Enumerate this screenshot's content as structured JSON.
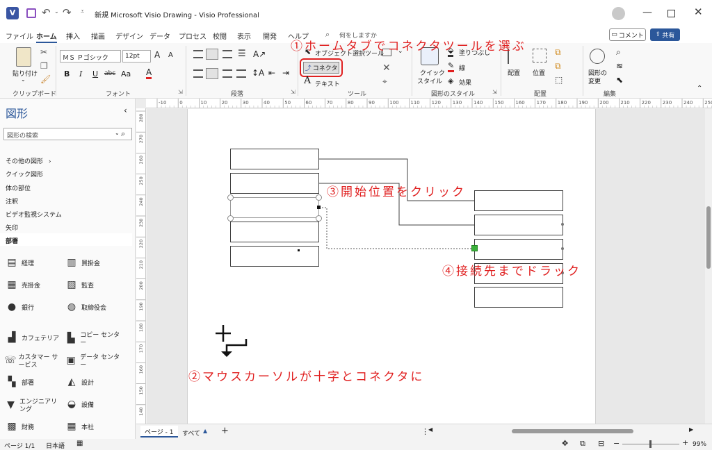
{
  "titlebar": {
    "title": "新規 Microsoft Visio Drawing  -  Visio Professional",
    "app_icon": "visio-icon",
    "save_icon": "save-icon"
  },
  "menubar": {
    "tabs": [
      "ファイル",
      "ホーム",
      "挿入",
      "描画",
      "デザイン",
      "データ",
      "プロセス",
      "校閲",
      "表示",
      "開発",
      "ヘルプ"
    ],
    "active_tab": "ホーム",
    "search_placeholder": "何をしますか",
    "comment_label": "コメント",
    "share_label": "共有"
  },
  "ribbon": {
    "clipboard": {
      "paste": "貼り付け",
      "label": "クリップボード"
    },
    "font": {
      "family": "ＭＳ Ｐゴシック",
      "size": "12pt",
      "bold": "B",
      "italic": "I",
      "underline": "U",
      "strike": "abc",
      "case": "Aa",
      "color": "A",
      "grow": "A",
      "shrink": "A",
      "label": "フォント"
    },
    "paragraph": {
      "label": "段落"
    },
    "tools": {
      "pointer": "オブジェクト選択ツール",
      "connector": "コネクタ",
      "text": "テキスト",
      "label": "ツール"
    },
    "shape_style": {
      "quick": "クイック",
      "quick2": "スタイル",
      "fill": "塗りつぶし",
      "line": "線",
      "effect": "効果",
      "label": "図形のスタイル"
    },
    "arrange": {
      "align": "配置",
      "position": "位置",
      "label": "配置"
    },
    "edit": {
      "change_shape": "図形の",
      "change_shape2": "変更",
      "label": "編集"
    }
  },
  "shapes_pane": {
    "title": "図形",
    "search_placeholder": "図形の検索",
    "more_shapes": "その他の図形",
    "categories": [
      "クイック図形",
      "体の部位",
      "注釈",
      "ビデオ監視システム",
      "矢印",
      "部署"
    ],
    "active_category": "部署",
    "stencils": [
      [
        "経理",
        "買掛金"
      ],
      [
        "売掛金",
        "監査"
      ],
      [
        "銀行",
        "取締役会"
      ],
      [
        "カフェテリア",
        "コピー センター"
      ],
      [
        "カスタマー サービス",
        "データ センター"
      ],
      [
        "部署",
        "設計"
      ],
      [
        "エンジニアリング",
        "設備"
      ],
      [
        "財務",
        "本社"
      ]
    ]
  },
  "ruler": {
    "top_ticks": [
      "-10",
      "0",
      "10",
      "20",
      "30",
      "40",
      "50",
      "60",
      "70",
      "80",
      "90",
      "100",
      "110",
      "120",
      "130",
      "140",
      "150",
      "160",
      "170",
      "180",
      "190",
      "200",
      "210",
      "220",
      "230",
      "240",
      "250"
    ],
    "left_ticks": [
      "280",
      "270",
      "260",
      "250",
      "240",
      "230",
      "220",
      "210",
      "200",
      "190",
      "180",
      "170",
      "160",
      "150",
      "140"
    ]
  },
  "annotations": {
    "a1": "①ホームタブでコネクタツールを選ぶ",
    "a2": "②マウスカーソルが十字とコネクタに",
    "a3": "③開始位置をクリック",
    "a4": "④接続先までドラック"
  },
  "page_tabs": {
    "page1": "ページ - 1",
    "all": "すべて"
  },
  "statusbar": {
    "page": "ページ 1/1",
    "lang": "日本語",
    "zoom": "99%"
  },
  "colors": {
    "accent": "#2b579a",
    "annotation": "#e02020",
    "connection_point": "#3cb13c"
  }
}
